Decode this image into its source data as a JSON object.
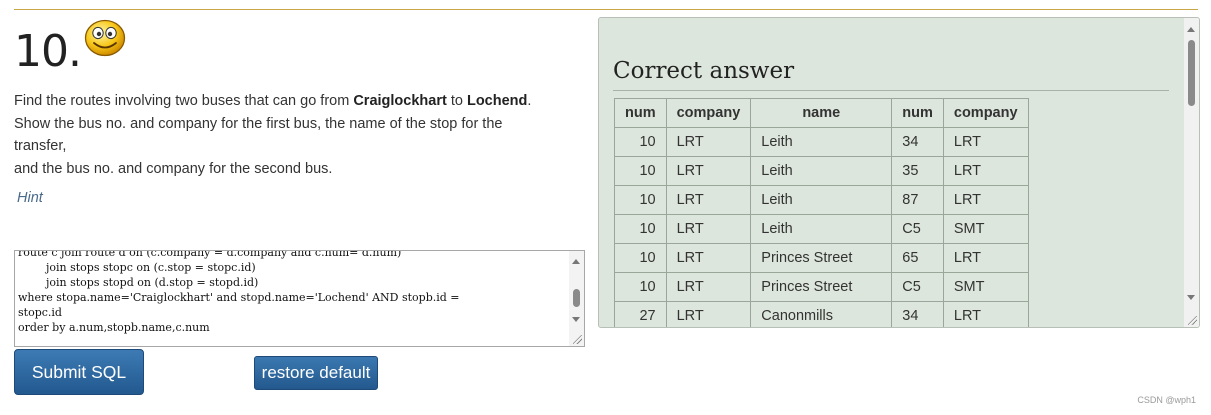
{
  "question": {
    "number": "10.",
    "line1_pre": "Find the routes involving two buses that can go from ",
    "from_stop": "Craiglockhart",
    "line1_mid": " to ",
    "to_stop": "Lochend",
    "line1_post": ".",
    "line2": "Show the bus no. and company for the first bus, the name of the stop for the",
    "line3": "transfer,",
    "line4": "and the bus no. and company for the second bus.",
    "hint": "Hint"
  },
  "editor": {
    "sql": "route c join route d on (c.company = d.company and c.num= d.num)\n        join stops stopc on (c.stop = stopc.id)\n        join stops stopd on (d.stop = stopd.id)\nwhere stopa.name='Craiglockhart' and stopd.name='Lochend' AND stopb.id =\nstopc.id\norder by a.num,stopb.name,c.num"
  },
  "buttons": {
    "submit": "Submit SQL",
    "restore": "restore default"
  },
  "answer": {
    "title": "Correct answer",
    "columns": [
      "num",
      "company",
      "name",
      "num",
      "company"
    ],
    "rows": [
      [
        "10",
        "LRT",
        "Leith",
        "34",
        "LRT"
      ],
      [
        "10",
        "LRT",
        "Leith",
        "35",
        "LRT"
      ],
      [
        "10",
        "LRT",
        "Leith",
        "87",
        "LRT"
      ],
      [
        "10",
        "LRT",
        "Leith",
        "C5",
        "SMT"
      ],
      [
        "10",
        "LRT",
        "Princes Street",
        "65",
        "LRT"
      ],
      [
        "10",
        "LRT",
        "Princes Street",
        "C5",
        "SMT"
      ],
      [
        "27",
        "LRT",
        "Canonmills",
        "34",
        "LRT"
      ]
    ]
  },
  "icons": {
    "smiley": "smiley-face-icon",
    "resize": "resize-grip-icon"
  },
  "colors": {
    "button_blue": "#2a6299",
    "answer_bg": "#dde6dd",
    "divider_gold": "#c9a646"
  },
  "watermark": "CSDN @wph1"
}
